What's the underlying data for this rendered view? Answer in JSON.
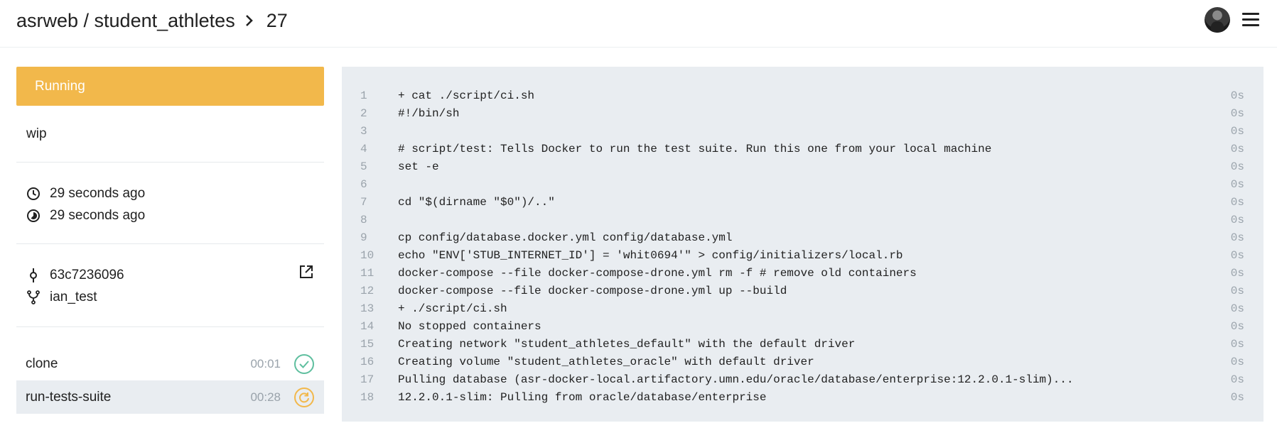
{
  "header": {
    "repo": "asrweb / student_athletes",
    "build_number": "27"
  },
  "sidebar": {
    "status": "Running",
    "message": "wip",
    "created": "29 seconds ago",
    "started": "29 seconds ago",
    "commit": "63c7236096",
    "branch": "ian_test",
    "steps": [
      {
        "name": "clone",
        "duration": "00:01",
        "state": "success"
      },
      {
        "name": "run-tests-suite",
        "duration": "00:28",
        "state": "running"
      }
    ]
  },
  "log": {
    "lines": [
      {
        "n": "1",
        "text": "+ cat ./script/ci.sh",
        "t": "0s"
      },
      {
        "n": "2",
        "text": "#!/bin/sh",
        "t": "0s"
      },
      {
        "n": "3",
        "text": "",
        "t": "0s"
      },
      {
        "n": "4",
        "text": "# script/test: Tells Docker to run the test suite. Run this one from your local machine",
        "t": "0s"
      },
      {
        "n": "5",
        "text": "set -e",
        "t": "0s"
      },
      {
        "n": "6",
        "text": "",
        "t": "0s"
      },
      {
        "n": "7",
        "text": "cd \"$(dirname \"$0\")/..\"",
        "t": "0s"
      },
      {
        "n": "8",
        "text": "",
        "t": "0s"
      },
      {
        "n": "9",
        "text": "cp config/database.docker.yml config/database.yml",
        "t": "0s"
      },
      {
        "n": "10",
        "text": "echo \"ENV['STUB_INTERNET_ID'] = 'whit0694'\" > config/initializers/local.rb",
        "t": "0s"
      },
      {
        "n": "11",
        "text": "docker-compose --file docker-compose-drone.yml rm -f # remove old containers",
        "t": "0s"
      },
      {
        "n": "12",
        "text": "docker-compose --file docker-compose-drone.yml up --build",
        "t": "0s"
      },
      {
        "n": "13",
        "text": "+ ./script/ci.sh",
        "t": "0s"
      },
      {
        "n": "14",
        "text": "No stopped containers",
        "t": "0s"
      },
      {
        "n": "15",
        "text": "Creating network \"student_athletes_default\" with the default driver",
        "t": "0s"
      },
      {
        "n": "16",
        "text": "Creating volume \"student_athletes_oracle\" with default driver",
        "t": "0s"
      },
      {
        "n": "17",
        "text": "Pulling database (asr-docker-local.artifactory.umn.edu/oracle/database/enterprise:12.2.0.1-slim)...",
        "t": "0s"
      },
      {
        "n": "18",
        "text": "12.2.0.1-slim: Pulling from oracle/database/enterprise",
        "t": "0s"
      }
    ]
  },
  "colors": {
    "running": "#f2b84b",
    "success": "#5fbf9f",
    "panel": "#e9edf1"
  }
}
